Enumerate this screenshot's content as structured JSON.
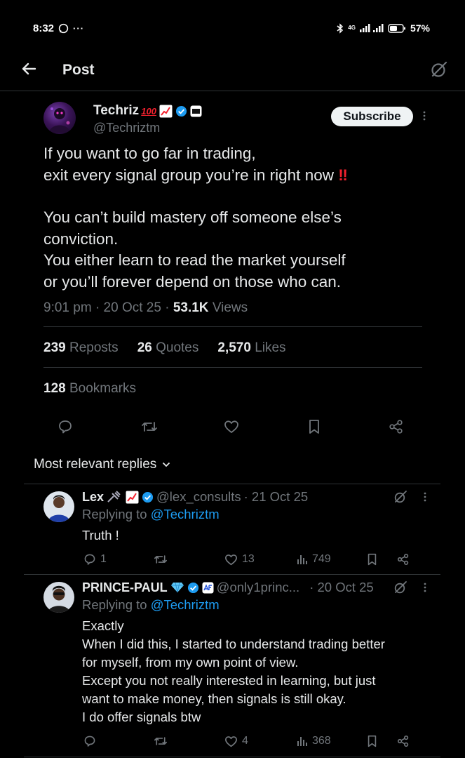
{
  "status_bar": {
    "time": "8:32",
    "network": "4G",
    "battery": "57%"
  },
  "header": {
    "title": "Post"
  },
  "post": {
    "author_name": "Techriz",
    "author_handle": "@Techriztm",
    "subscribe_label": "Subscribe",
    "paragraph1": "If you want to go far in trading,\nexit every signal group you’re in right now",
    "paragraph2": "You can’t build mastery off someone else’s\nconviction.\nYou either learn to read the market yourself\nor you’ll forever depend on those who can.",
    "time": "9:01 pm",
    "date": "20 Oct 25",
    "views_count": "53.1K",
    "views_label": "Views",
    "reposts_count": "239",
    "reposts_label": "Reposts",
    "quotes_count": "26",
    "quotes_label": "Quotes",
    "likes_count": "2,570",
    "likes_label": "Likes",
    "bookmarks_count": "128",
    "bookmarks_label": "Bookmarks"
  },
  "replies_heading": "Most relevant replies",
  "replies": [
    {
      "name": "Lex",
      "handle": "@lex_consults",
      "date": "· 21 Oct 25",
      "replying_prefix": "Replying to",
      "replying_to": "@Techriztm",
      "text": "Truth !",
      "reply_count": "1",
      "like_count": "13",
      "view_count": "749"
    },
    {
      "name": "PRINCE-PAUL",
      "handle": "@only1princ...",
      "date": "· 20 Oct 25",
      "replying_prefix": "Replying to",
      "replying_to": "@Techriztm",
      "text": "Exactly\nWhen I did this, I started to understand trading better\nfor myself, from my own point of view.\nExcept you not really interested in learning,  but just\nwant to make money, then signals is still okay.\nI do offer signals btw",
      "reply_count": "",
      "like_count": "4",
      "view_count": "368"
    }
  ],
  "colors": {
    "background": "#000000",
    "text": "#e7e9ea",
    "muted": "#71767b",
    "link": "#1d9bf0",
    "divider": "#2f3336",
    "verified": "#1d9bf0"
  },
  "icons": [
    "whatsapp-icon",
    "more-icon",
    "bluetooth-icon",
    "signal-icon",
    "battery-icon",
    "back-arrow-icon",
    "grok-icon",
    "verified-badge-icon",
    "reply-icon",
    "repost-icon",
    "like-icon",
    "bookmark-icon",
    "share-icon",
    "views-icon",
    "chevron-down-icon"
  ]
}
